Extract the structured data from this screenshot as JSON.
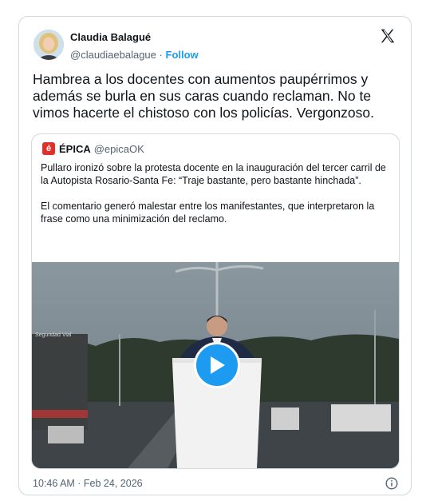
{
  "author": {
    "display_name": "Claudia Balagué",
    "handle": "@claudiaebalague",
    "separator": "·",
    "follow_label": "Follow"
  },
  "tweet": {
    "text": "Hambrea a los docentes con aumentos paupérrimos y además se burla en sus caras cuando reclaman. No te vimos hacerte el chistoso con los policías. Vergonzoso."
  },
  "quote": {
    "avatar_letter": "é",
    "name": "ÉPICA",
    "handle": "@epicaOK",
    "paragraph_1": "Pullaro ironizó sobre la protesta docente en la inauguración del tercer carril de la Autopista Rosario-Santa Fe: “Traje bastante, pero bastante hinchada”.",
    "paragraph_2": "El comentario generó malestar entre los manifestantes, que interpretaron la frase como una minimización del reclamo."
  },
  "media": {
    "watermark": "Seguridad Vial"
  },
  "footer": {
    "timestamp": "10:46 AM · Feb 24, 2026"
  },
  "icons": {
    "logo": "x-logo-icon",
    "play": "play-icon",
    "info": "info-icon"
  },
  "colors": {
    "accent": "#1d9bf0",
    "text": "#0f1419",
    "muted": "#536471",
    "border": "#cfd9de",
    "brand_red": "#e0302b"
  }
}
